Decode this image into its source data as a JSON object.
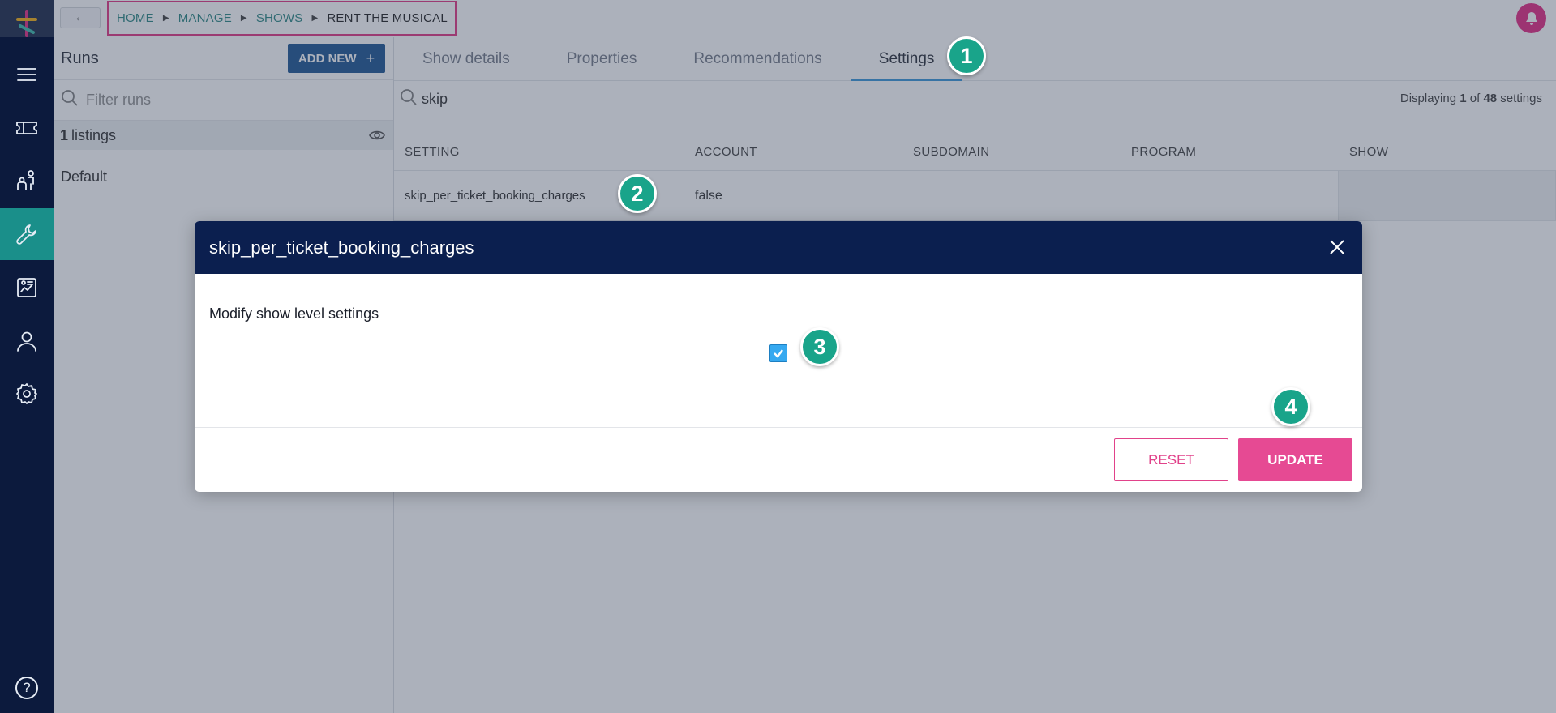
{
  "breadcrumb": {
    "items": [
      "HOME",
      "MANAGE",
      "SHOWS",
      "RENT THE MUSICAL"
    ]
  },
  "runs": {
    "title": "Runs",
    "add_new_label": "ADD NEW",
    "filter_placeholder": "Filter runs",
    "listings_count": "1",
    "listings_label": "listings",
    "default_label": "Default"
  },
  "tabs": [
    "Show details",
    "Properties",
    "Recommendations",
    "Settings"
  ],
  "settings_search": {
    "value": "skip",
    "displaying_prefix": "Displaying",
    "displaying_shown": "1",
    "displaying_of": "of",
    "displaying_total": "48",
    "displaying_suffix": "settings"
  },
  "table": {
    "headers": [
      "SETTING",
      "ACCOUNT",
      "SUBDOMAIN",
      "PROGRAM",
      "SHOW"
    ],
    "row": {
      "setting": "skip_per_ticket_booking_charges",
      "account": "false",
      "subdomain": "",
      "program": "",
      "show": ""
    }
  },
  "modal": {
    "title": "skip_per_ticket_booking_charges",
    "label": "Modify show level settings",
    "checked": true,
    "reset_label": "RESET",
    "update_label": "UPDATE"
  },
  "markers": [
    "1",
    "2",
    "3",
    "4"
  ],
  "colors": {
    "rail": "#0c1a3d",
    "rail_active": "#1a8f8a",
    "modal_header": "#0b1f4f",
    "accent_pink": "#e64a93",
    "marker": "#19a48a",
    "add_button": "#0e4a8a"
  },
  "icons": [
    "logo",
    "menu-icon",
    "ticket-icon",
    "audience-icon",
    "wrench-icon",
    "reports-icon",
    "user-icon",
    "gear-icon",
    "help-icon",
    "bell-icon",
    "search-icon",
    "eye-icon",
    "close-icon",
    "check-icon"
  ]
}
